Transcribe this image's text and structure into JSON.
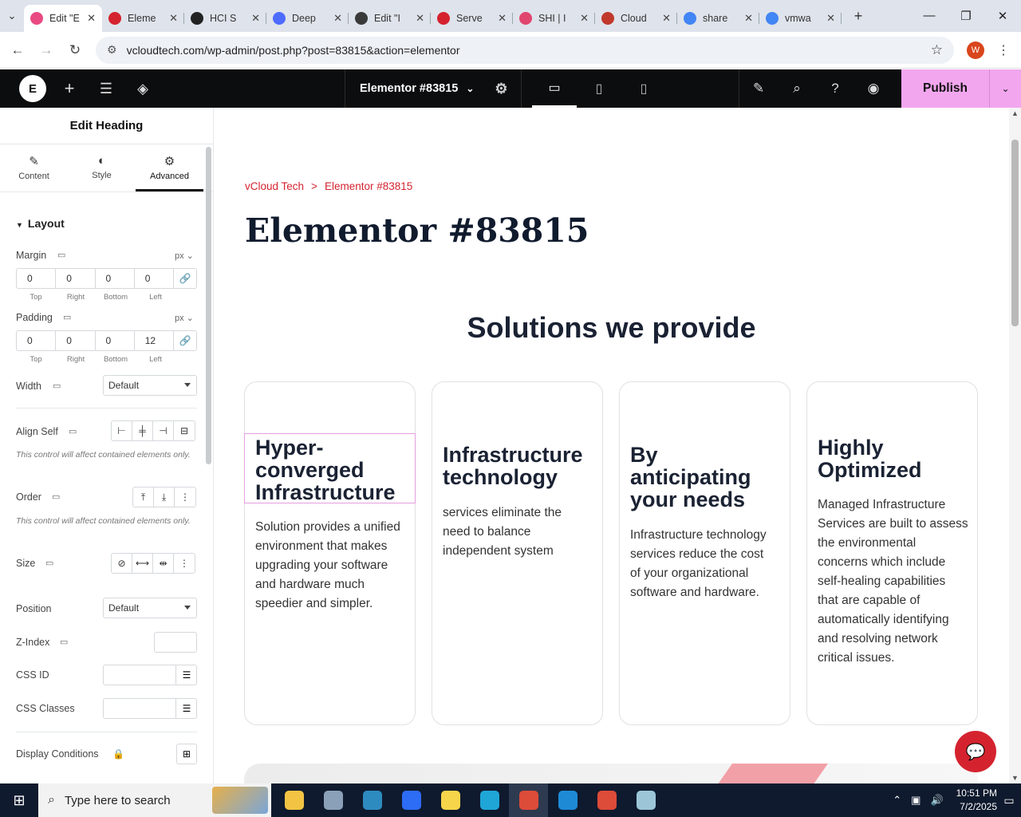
{
  "browser": {
    "tabs": [
      {
        "title": "Edit \"E",
        "fav_color": "#e94a82",
        "active": true
      },
      {
        "title": "Eleme",
        "fav_color": "#d4232f"
      },
      {
        "title": "HCI S",
        "fav_color": "#222222"
      },
      {
        "title": "Deep",
        "fav_color": "#4d6bfe"
      },
      {
        "title": "Edit \"I",
        "fav_color": "#3a3a3a"
      },
      {
        "title": "Serve",
        "fav_color": "#d4232f"
      },
      {
        "title": "SHI | I",
        "fav_color": "#e0466e"
      },
      {
        "title": "Cloud",
        "fav_color": "#c0392b"
      },
      {
        "title": "share",
        "fav_color": "#4285f4"
      },
      {
        "title": "vmwa",
        "fav_color": "#4285f4"
      }
    ],
    "url": "vcloudtech.com/wp-admin/post.php?post=83815&action=elementor",
    "profile_initial": "W"
  },
  "editor": {
    "doc_title": "Elementor #83815",
    "publish_label": "Publish"
  },
  "panel": {
    "title": "Edit Heading",
    "tabs": [
      {
        "label": "Content",
        "icon": "pencil-icon"
      },
      {
        "label": "Style",
        "icon": "contrast-icon"
      },
      {
        "label": "Advanced",
        "icon": "gear-icon"
      }
    ],
    "section_layout": "Layout",
    "margin": {
      "label": "Margin",
      "unit": "px",
      "values": [
        "0",
        "0",
        "0",
        "0"
      ]
    },
    "padding": {
      "label": "Padding",
      "unit": "px",
      "values": [
        "0",
        "0",
        "0",
        "12"
      ]
    },
    "side_labels": [
      "Top",
      "Right",
      "Bottom",
      "Left"
    ],
    "width": {
      "label": "Width",
      "value": "Default"
    },
    "align_self": {
      "label": "Align Self"
    },
    "note": "This control will affect contained elements only.",
    "order": {
      "label": "Order"
    },
    "size": {
      "label": "Size"
    },
    "position": {
      "label": "Position",
      "value": "Default"
    },
    "zindex": {
      "label": "Z-Index"
    },
    "css_id": {
      "label": "CSS ID"
    },
    "css_classes": {
      "label": "CSS Classes"
    },
    "display_conditions": {
      "label": "Display Conditions"
    }
  },
  "page": {
    "breadcrumb": [
      "vCloud Tech",
      "Elementor #83815"
    ],
    "breadcrumb_sep": ">",
    "title": "Elementor #83815",
    "section_heading": "Solutions we provide",
    "cards": [
      {
        "heading": [
          "Hyper-",
          "converged",
          "Infrastructure"
        ],
        "text": "Solution provides a unified environment that makes upgrading your software and hardware much speedier and simpler."
      },
      {
        "heading": [
          "Infrastructure",
          "technology"
        ],
        "text": "services eliminate the need to balance independent system"
      },
      {
        "heading": [
          "By",
          "anticipating",
          "your needs"
        ],
        "text": "Infrastructure technology services reduce the cost of your organizational software and hardware."
      },
      {
        "heading": [
          "Highly",
          "Optimized"
        ],
        "text": "Managed Infrastructure Services are built to assess the environmental concerns which include self-healing capabilities that are capable of automatically identifying and resolving network critical issues."
      }
    ]
  },
  "taskbar": {
    "search_placeholder": "Type here to search",
    "time": "10:51 PM",
    "date": "7/2/2025",
    "apps": [
      {
        "name": "file-explorer-icon",
        "color": "#f3c443"
      },
      {
        "name": "app-icon",
        "color": "#8aa0b8"
      },
      {
        "name": "app-icon",
        "color": "#2e8bbf"
      },
      {
        "name": "zoom-icon",
        "color": "#2d6cf5"
      },
      {
        "name": "sticky-notes-icon",
        "color": "#f7d54a"
      },
      {
        "name": "edge-icon",
        "color": "#1fa6d6"
      },
      {
        "name": "chrome-icon",
        "color": "#dd4b39",
        "active": true
      },
      {
        "name": "vscode-icon",
        "color": "#1e8ad6"
      },
      {
        "name": "chrome-icon",
        "color": "#dd4b39"
      },
      {
        "name": "app-icon",
        "color": "#9cc6d8"
      }
    ]
  }
}
